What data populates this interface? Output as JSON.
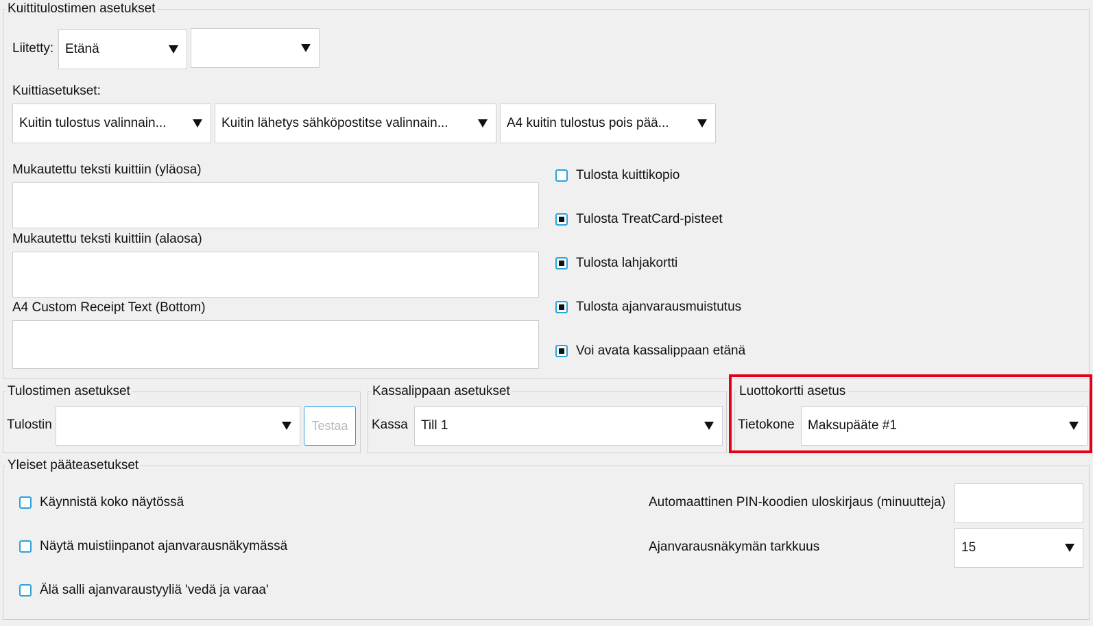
{
  "receipt_printer": {
    "legend": "Kuittitulostimen asetukset",
    "connected_label": "Liitetty:",
    "connected_value": "Etänä",
    "second_value": "",
    "receipt_settings_label": "Kuittiasetukset:",
    "receipt_print_value": "Kuitin tulostus valinnain...",
    "receipt_email_value": "Kuitin lähetys sähköpostitse valinnain...",
    "a4_print_value": "A4 kuitin tulostus pois pää...",
    "custom_top_label": "Mukautettu teksti kuittiin (yläosa)",
    "custom_bottom_label": "Mukautettu teksti kuittiin (alaosa)",
    "a4_custom_label": "A4 Custom Receipt Text (Bottom)",
    "checkboxes": [
      {
        "label": "Tulosta kuittikopio",
        "checked": false
      },
      {
        "label": "Tulosta TreatCard-pisteet",
        "checked": true
      },
      {
        "label": "Tulosta lahjakortti",
        "checked": true
      },
      {
        "label": "Tulosta ajanvarausmuistutus",
        "checked": true
      },
      {
        "label": "Voi avata kassalippaan etänä",
        "checked": true
      }
    ]
  },
  "printer": {
    "legend": "Tulostimen asetukset",
    "printer_label": "Tulostin",
    "printer_value": "",
    "test_button": "Testaa"
  },
  "cash_drawer": {
    "legend": "Kassalippaan asetukset",
    "till_label": "Kassa",
    "till_value": "Till 1"
  },
  "credit_card": {
    "legend": "Luottokortti asetus",
    "computer_label": "Tietokone",
    "terminal_value": "Maksupääte #1"
  },
  "general": {
    "legend": "Yleiset pääteasetukset",
    "checkboxes": [
      {
        "label": "Käynnistä koko näytössä",
        "checked": false
      },
      {
        "label": "Näytä muistiinpanot ajanvarausnäkymässä",
        "checked": false
      },
      {
        "label": "Älä salli ajanvaraustyyliä 'vedä ja varaa'",
        "checked": false
      }
    ],
    "pin_logout_label": "Automaattinen PIN-koodien uloskirjaus (minuutteja)",
    "pin_logout_value": "",
    "precision_label": "Ajanvarausnäkymän tarkkuus",
    "precision_value": "15"
  },
  "colors": {
    "accent": "#2aa3dc",
    "highlight": "#e3001b"
  }
}
